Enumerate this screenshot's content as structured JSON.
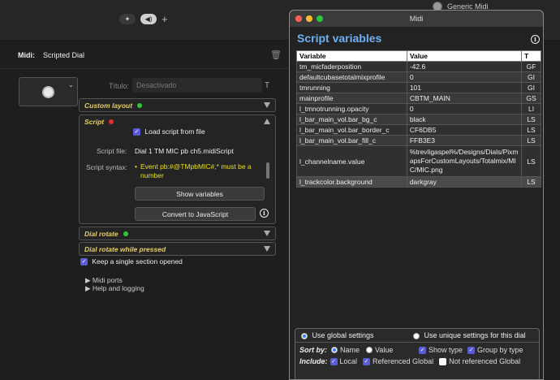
{
  "toolbar": {
    "pin_icon": "pin-icon",
    "sound_icon": "speaker-icon",
    "plus_label": "+"
  },
  "app_title": "Generic Midi",
  "header": {
    "midi_label": "Midi:",
    "midi_value": "Scripted Dial"
  },
  "dial": {
    "titulo_label": "Título:",
    "titulo_value": "Desactivado",
    "titulo_suffix": "T"
  },
  "sections": {
    "custom_layout": {
      "label": "Custom layout",
      "status_color": "#32c832"
    },
    "script": {
      "label": "Script",
      "status_color": "#e03030",
      "load_script_label": "Load script from file",
      "script_file_label": "Script file:",
      "script_file_value": "Dial 1 TM MIC pb ch5.midiScript",
      "script_syntax_label": "Script syntax:",
      "script_syntax_error": "Event pb:#@TMpbMIC#,* must be a number",
      "show_variables_label": "Show variables",
      "convert_label": "Convert to JavaScript"
    },
    "dial_rotate": {
      "label": "Dial rotate",
      "status_color": "#32c832"
    },
    "dial_rotate_pressed": {
      "label": "Dial rotate while pressed"
    }
  },
  "keep_single_label": "Keep a single section opened",
  "links": {
    "midi_ports": "▶ Midi ports",
    "help": "▶ Help and logging"
  },
  "window": {
    "title": "Midi",
    "heading": "Script variables",
    "columns": [
      "Variable",
      "Value",
      "T"
    ],
    "rows": [
      {
        "name": "tm_micfaderposition",
        "value": "-42.6",
        "type": "GF"
      },
      {
        "name": "defaultcubasetotalmixprofile",
        "value": "0",
        "type": "GI"
      },
      {
        "name": "tmrunning",
        "value": "101",
        "type": "GI"
      },
      {
        "name": "mainprofile",
        "value": "CBTM_MAIN",
        "type": "GS"
      },
      {
        "name": "l_tmnotrunning.opacity",
        "value": "0",
        "type": "LI"
      },
      {
        "name": "l_bar_main_vol.bar_bg_c",
        "value": "black",
        "type": "LS"
      },
      {
        "name": "l_bar_main_vol.bar_border_c",
        "value": "CF6DB5",
        "type": "LS"
      },
      {
        "name": "l_bar_main_vol.bar_fill_c",
        "value": "FFB3E3",
        "type": "LS"
      },
      {
        "name": "l_channelname.value",
        "value": "%trevligaspel%/Designs/Dials/PixmapsForCustomLayouts/Totalmix/MIC/MIC.png",
        "type": "LS"
      },
      {
        "name": "l_trackcolor.background",
        "value": "darkgray",
        "type": "LS"
      }
    ],
    "use_global": "Use global settings",
    "use_unique": "Use unique settings for this dial",
    "sort_by_label": "Sort by:",
    "sort_name": "Name",
    "sort_value": "Value",
    "show_type": "Show type",
    "group_by_type": "Group by type",
    "include_label": "Include:",
    "include_local": "Local",
    "include_referenced": "Referenced Global",
    "include_not_referenced": "Not referenced Global"
  }
}
